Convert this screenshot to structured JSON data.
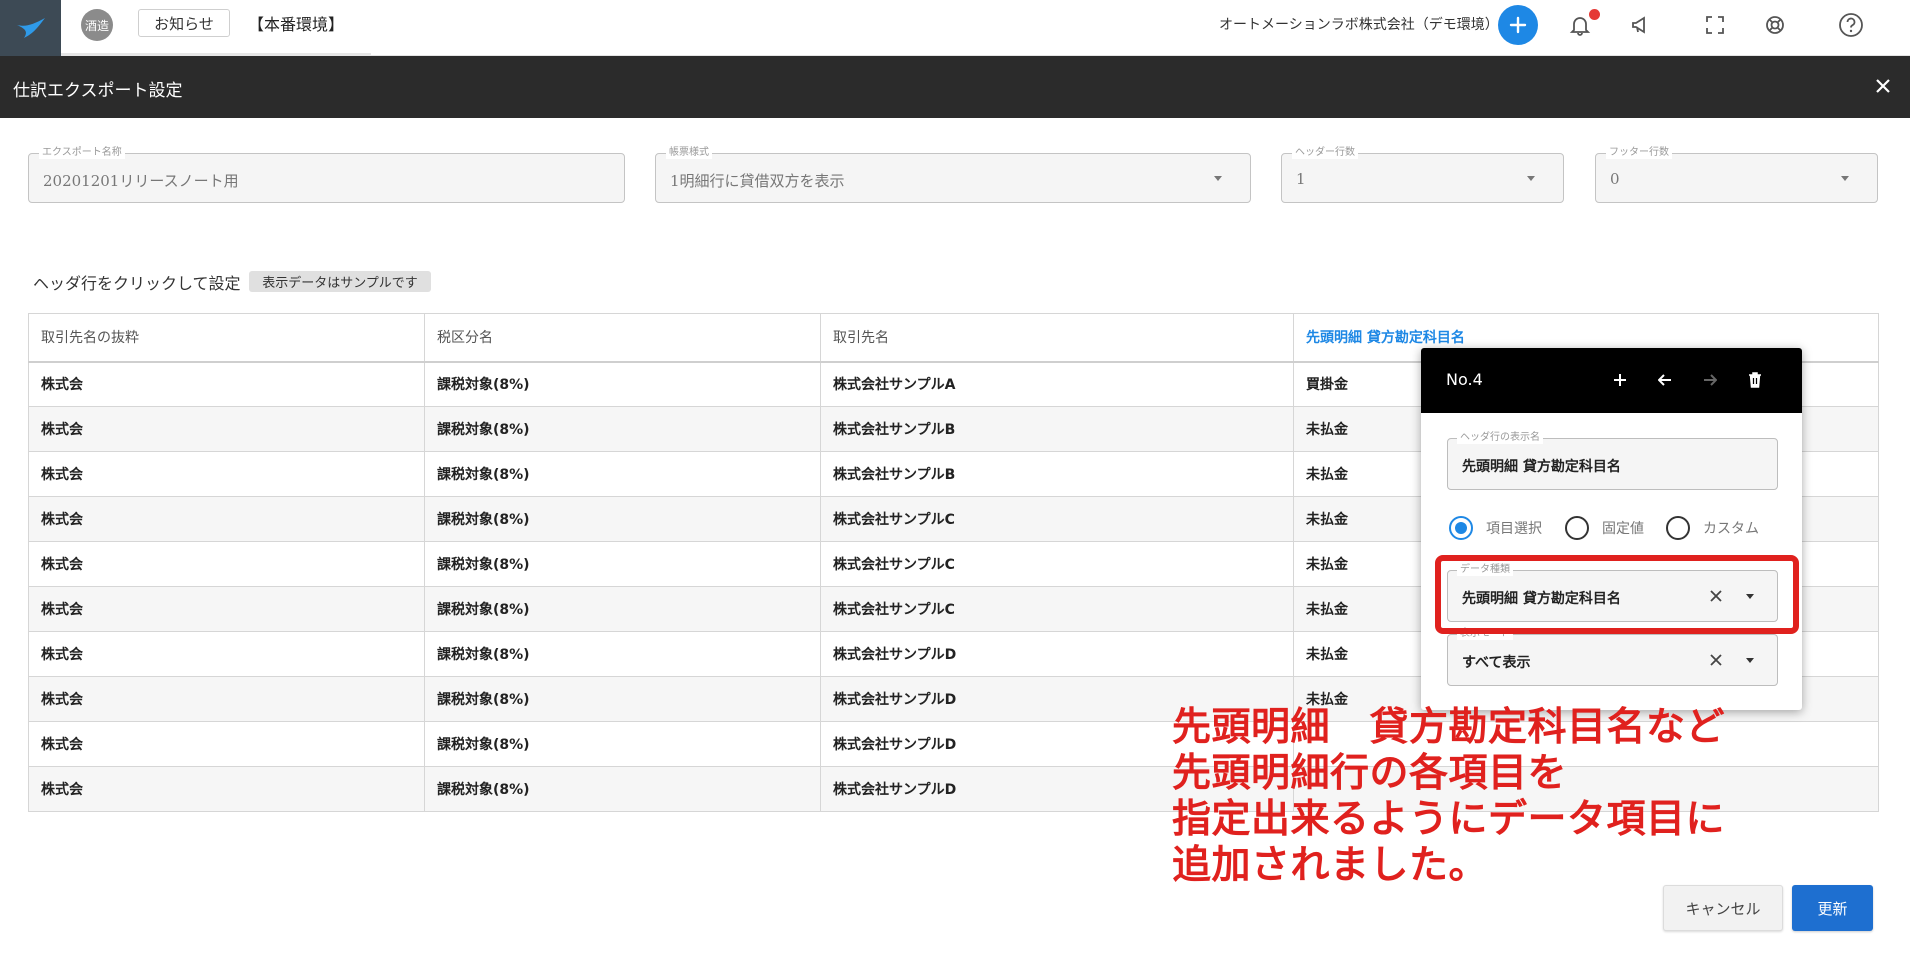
{
  "topbar": {
    "logo_icon": "bird-logo-icon",
    "tenant_avatar": "酒造",
    "notice_label": "お知らせ",
    "env_label": "【本番環境】",
    "company": "オートメーションラボ株式会社（デモ環境）",
    "icons": [
      "plus-icon",
      "bell-icon",
      "megaphone-icon",
      "fullscreen-icon",
      "support-icon",
      "help-icon"
    ],
    "notification_color": "#e53935",
    "accent_color": "#1e88e5"
  },
  "dialog": {
    "title": "仕訳エクスポート設定",
    "close_icon": "close-icon"
  },
  "form": {
    "export_name": {
      "label": "エクスポート名称",
      "value": "20201201リリースノート用"
    },
    "format": {
      "label": "帳票様式",
      "value": "1明細行に貸借双方を表示"
    },
    "header_rows": {
      "label": "ヘッダー行数",
      "value": "1"
    },
    "footer_rows": {
      "label": "フッター行数",
      "value": "0"
    }
  },
  "hint": {
    "text": "ヘッダ行をクリックして設定",
    "badge": "表示データはサンプルです"
  },
  "table": {
    "headers": [
      "取引先名の抜粋",
      "税区分名",
      "取引先名",
      "先頭明細 貸方勘定科目名"
    ],
    "active_column": 3,
    "rows": [
      [
        "株式会",
        "課税対象(8%)",
        "株式会社サンプルA",
        "買掛金"
      ],
      [
        "株式会",
        "課税対象(8%)",
        "株式会社サンプルB",
        "未払金"
      ],
      [
        "株式会",
        "課税対象(8%)",
        "株式会社サンプルB",
        "未払金"
      ],
      [
        "株式会",
        "課税対象(8%)",
        "株式会社サンプルC",
        "未払金"
      ],
      [
        "株式会",
        "課税対象(8%)",
        "株式会社サンプルC",
        "未払金"
      ],
      [
        "株式会",
        "課税対象(8%)",
        "株式会社サンプルC",
        "未払金"
      ],
      [
        "株式会",
        "課税対象(8%)",
        "株式会社サンプルD",
        "未払金"
      ],
      [
        "株式会",
        "課税対象(8%)",
        "株式会社サンプルD",
        "未払金"
      ],
      [
        "株式会",
        "課税対象(8%)",
        "株式会社サンプルD",
        ""
      ],
      [
        "株式会",
        "課税対象(8%)",
        "株式会社サンプルD",
        ""
      ]
    ]
  },
  "popup": {
    "title": "No.4",
    "header_icons": [
      "plus-icon",
      "arrow-left-icon",
      "arrow-right-icon",
      "trash-icon"
    ],
    "display_name": {
      "label": "ヘッダ行の表示名",
      "value": "先頭明細 貸方勘定科目名"
    },
    "radios": [
      {
        "label": "項目選択",
        "checked": true
      },
      {
        "label": "固定値",
        "checked": false
      },
      {
        "label": "カスタム",
        "checked": false
      }
    ],
    "data_type": {
      "label": "データ種類",
      "value": "先頭明細 貸方勘定科目名"
    },
    "display_mode": {
      "label": "表示モード",
      "value": "すべて表示"
    }
  },
  "annotation": {
    "text": "先頭明細　貸方勘定科目名など\n先頭明細行の各項目を\n指定出来るようにデータ項目に\n追加されました。",
    "color": "#e0211e"
  },
  "footer": {
    "cancel_label": "キャンセル",
    "update_label": "更新"
  }
}
